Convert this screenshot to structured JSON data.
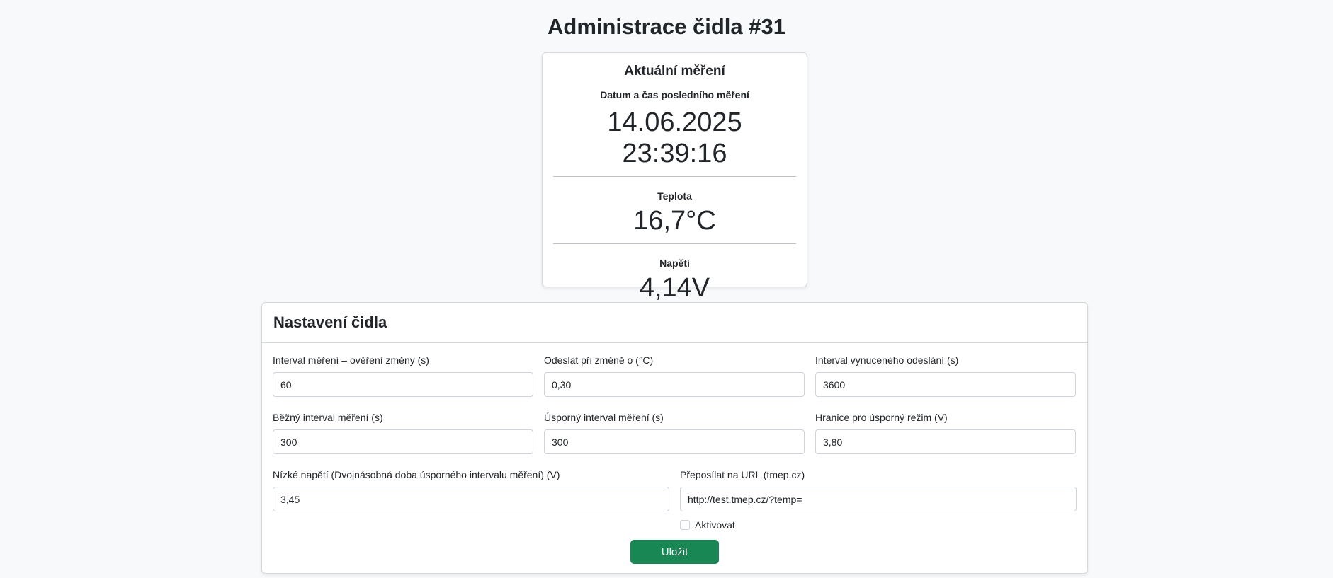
{
  "page": {
    "title": "Administrace čidla #31"
  },
  "measurement": {
    "title": "Aktuální měření",
    "datetime_label": "Datum a čas posledního měření",
    "datetime_value": "14.06.2025 23:39:16",
    "temperature_label": "Teplota",
    "temperature_value": "16,7°C",
    "voltage_label": "Napětí",
    "voltage_value": "4,14V"
  },
  "settings": {
    "title": "Nastavení čidla",
    "fields": {
      "interval_check_label": "Interval měření – ověření změny (s)",
      "interval_check_value": "60",
      "send_on_change_label": "Odeslat při změně o (°C)",
      "send_on_change_value": "0,30",
      "forced_send_label": "Interval vynuceného odeslání (s)",
      "forced_send_value": "3600",
      "normal_interval_label": "Běžný interval měření (s)",
      "normal_interval_value": "300",
      "eco_interval_label": "Úsporný interval měření (s)",
      "eco_interval_value": "300",
      "eco_threshold_label": "Hranice pro úsporný režim (V)",
      "eco_threshold_value": "3,80",
      "low_voltage_label": "Nízké napětí (Dvojnásobná doba úsporného intervalu měření) (V)",
      "low_voltage_value": "3,45",
      "forward_url_label": "Přeposílat na URL (tmep.cz)",
      "forward_url_value": "http://test.tmep.cz/?temp="
    },
    "activate_label": "Aktivovat",
    "activate_checked": false,
    "save_label": "Uložit"
  },
  "colors": {
    "primary_button": "#198754",
    "background": "#f8f9fa"
  }
}
